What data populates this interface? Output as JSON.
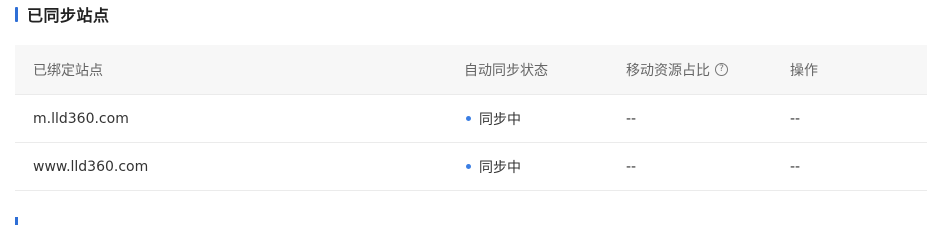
{
  "section": {
    "title": "已同步站点"
  },
  "table": {
    "columns": [
      "已绑定站点",
      "自动同步状态",
      "移动资源占比",
      "操作"
    ],
    "rows": [
      {
        "site": "m.lld360.com",
        "status": "同步中",
        "ratio": "--",
        "action": "--"
      },
      {
        "site": "www.lld360.com",
        "status": "同步中",
        "ratio": "--",
        "action": "--"
      }
    ]
  },
  "icons": {
    "help": "question-circle-icon",
    "status": "status-dot-icon"
  },
  "colors": {
    "accent": "#2f6fd6",
    "status_dot": "#3b7ee3",
    "header_bg": "#f7f7f7"
  }
}
